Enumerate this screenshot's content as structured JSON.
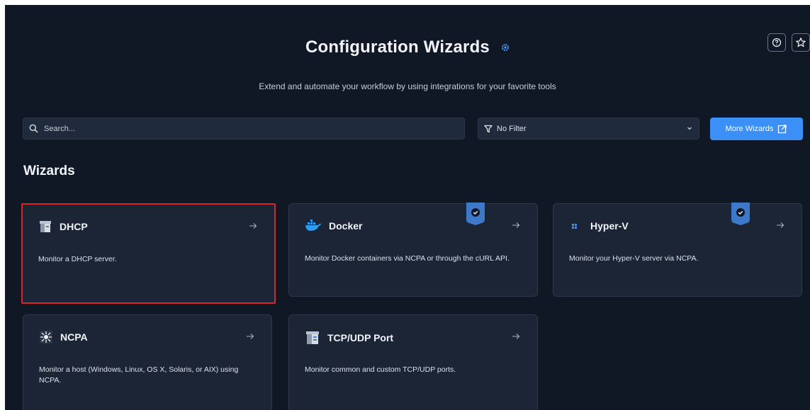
{
  "header": {
    "title": "Configuration Wizards",
    "subtitle": "Extend and automate your workflow by using integrations for your favorite tools"
  },
  "toolbar": {
    "search_placeholder": "Search...",
    "filter_value": "No Filter",
    "more_button_label": "More Wizards"
  },
  "section": {
    "title": "Wizards"
  },
  "cards": [
    {
      "title": "DHCP",
      "description": "Monitor a DHCP server.",
      "icon": "server-icon",
      "selected": true,
      "verified": false
    },
    {
      "title": "Docker",
      "description": "Monitor Docker containers via NCPA or through the cURL API.",
      "icon": "docker-icon",
      "selected": false,
      "verified": true
    },
    {
      "title": "Hyper-V",
      "description": "Monitor your Hyper-V server via NCPA.",
      "icon": "windows-icon",
      "selected": false,
      "verified": true
    },
    {
      "title": "NCPA",
      "description": "Monitor a host (Windows, Linux, OS X, Solaris, or AIX) using NCPA.",
      "icon": "ncpa-icon",
      "selected": false,
      "verified": false
    },
    {
      "title": "TCP/UDP Port",
      "description": "Monitor common and custom TCP/UDP ports.",
      "icon": "port-server-icon",
      "selected": false,
      "verified": false
    }
  ],
  "colors": {
    "background": "#101826",
    "card": "#1b2536",
    "accent": "#3b8ff5",
    "selected_border": "#e02424",
    "badge": "#3d78c9"
  }
}
